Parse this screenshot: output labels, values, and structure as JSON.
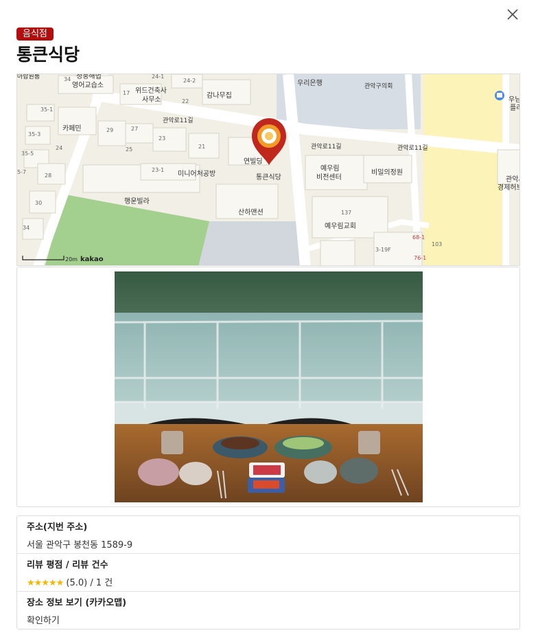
{
  "modal": {
    "category": "음식점",
    "title": "통큰식당"
  },
  "map": {
    "provider": "kakao",
    "scale_label": "20m",
    "labels": {
      "l1": "아랍원룸",
      "l2": "정풍해법",
      "l3": "영어교습소",
      "l4": "위드건축사",
      "l5": "사무소",
      "l6": "감나무집",
      "l7": "우리은행",
      "l8": "관악구의회",
      "l9": "카페민",
      "l10": "관악로11길",
      "l11": "연빌딩",
      "l12": "통큰식당",
      "l13": "미니어처공방",
      "l14": "행운빌라",
      "l15": "산하맨션",
      "l16": "예우림",
      "l17": "비전센터",
      "l18": "비밀의정원",
      "l19": "예우림교회",
      "l20": "관악사",
      "l21": "경제허브",
      "l22": "우님",
      "l23": "플리",
      "l24": "관악로11길",
      "l25": "관악로11길",
      "n1": "34",
      "n2": "24-1",
      "n3": "24-2",
      "n4": "17",
      "n5": "22",
      "n6": "35-1",
      "n7": "35-3",
      "n8": "35-5",
      "n9": "5-7",
      "n10": "29",
      "n11": "27",
      "n12": "23",
      "n13": "25",
      "n14": "24",
      "n15": "21",
      "n16": "28",
      "n17": "30",
      "n18": "34",
      "n19": "23-1",
      "n20": "137",
      "n21": "3-19F",
      "n22": "103",
      "n23": "68-1",
      "n24": "76-1"
    }
  },
  "details": {
    "address_label": "주소(지번 주소)",
    "address_value": "서울 관악구 봉천동 1589-9",
    "review_label": "리뷰 평점 / 리뷰 건수",
    "review_stars": "★★★★★",
    "review_value": " (5.0) / 1 건",
    "place_label": "장소 정보 보기 (카카오맵)",
    "place_link": "확인하기"
  },
  "colors": {
    "badge": "#b30e0e",
    "pin": "#c0281d",
    "star": "#f5b800"
  }
}
